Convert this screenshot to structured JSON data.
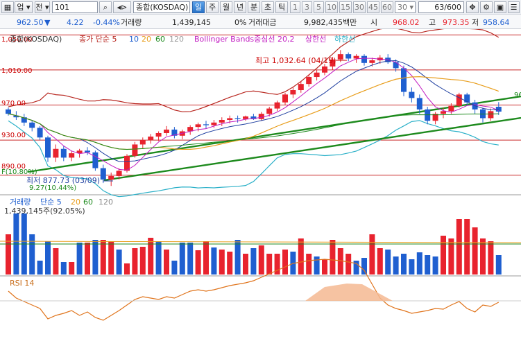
{
  "toolbar": {
    "item1": "업",
    "item2": "전",
    "code": "101",
    "market_name": "종합(KOSDAQ)",
    "periods": [
      "일",
      "주",
      "월",
      "년",
      "분",
      "초",
      "틱"
    ],
    "selected_period": "일",
    "numbers": [
      "1",
      "3",
      "5",
      "10",
      "15",
      "30",
      "45",
      "60"
    ],
    "num_select": "30",
    "count": "63",
    "total": "/600"
  },
  "info": {
    "price": "962.50",
    "change_icon": "down-triangle-icon",
    "change": "4.22",
    "change_pct": "-0.44%",
    "volume_label": "거래량",
    "volume": "1,439,145",
    "volume_ratio": "0%",
    "amount_label": "거래대금",
    "amount": "9,982,435백만",
    "open_label": "시",
    "open": "968.02",
    "high_label": "고",
    "high": "973.35",
    "low_label": "저",
    "low": "958.64"
  },
  "colors": {
    "up": "#e8232e",
    "down": "#1f5fd0",
    "ma": "#b8261f",
    "bb_center": "#c21cc2"
  },
  "price_panel": {
    "ytick_labels": [
      "1,050.00",
      "1,010.00",
      "970.00",
      "930.00",
      "890.00"
    ],
    "legend_title": "종합(KOSDAQ)",
    "legend_ma": "종가 단순 5",
    "legend_ma10": "10",
    "legend_ma20": "20",
    "legend_ma60": "60",
    "legend_ma120": "120",
    "legend_bb": "Bollinger Bands중심선 20,2",
    "legend_upper": "상한선",
    "legend_lower": "하한선",
    "high_annotation": "최고 1,032.64 (04/19)",
    "low_annotation": "최저 877.73 (03/09)",
    "left_marker_1": "F(10.80%)",
    "left_marker_2": "9.27(10.44%)",
    "right_edge_label": "96"
  },
  "volume_panel": {
    "legend_title": "거래량",
    "legend_ma": "단순 5",
    "legend_ma20": "20",
    "legend_ma60": "60",
    "legend_ma120": "120",
    "max_label": "1,439,145주(92.05%)"
  },
  "rsi_panel": {
    "legend": "RSI 14"
  },
  "chart_data": {
    "type": "candlestick",
    "ylim": [
      870,
      1055
    ],
    "candles": [
      [
        965,
        967,
        958,
        960
      ],
      [
        958,
        963,
        953,
        956
      ],
      [
        956,
        960,
        946,
        950
      ],
      [
        950,
        952,
        940,
        944
      ],
      [
        944,
        946,
        930,
        933
      ],
      [
        933,
        935,
        905,
        910
      ],
      [
        910,
        925,
        905,
        920
      ],
      [
        920,
        923,
        906,
        910
      ],
      [
        910,
        918,
        906,
        915
      ],
      [
        915,
        920,
        910,
        918
      ],
      [
        918,
        922,
        913,
        916
      ],
      [
        916,
        918,
        895,
        898
      ],
      [
        898,
        902,
        881,
        885
      ],
      [
        885,
        893,
        877.73,
        889
      ],
      [
        889,
        898,
        885,
        895
      ],
      [
        895,
        914,
        893,
        912
      ],
      [
        912,
        928,
        910,
        925
      ],
      [
        925,
        933,
        920,
        930
      ],
      [
        930,
        937,
        926,
        934
      ],
      [
        934,
        940,
        929,
        938
      ],
      [
        938,
        946,
        935,
        942
      ],
      [
        942,
        945,
        932,
        935
      ],
      [
        935,
        942,
        931,
        940
      ],
      [
        940,
        947,
        936,
        945
      ],
      [
        945,
        950,
        940,
        948
      ],
      [
        948,
        952,
        943,
        947
      ],
      [
        947,
        953,
        944,
        950
      ],
      [
        950,
        956,
        946,
        953
      ],
      [
        953,
        958,
        949,
        955
      ],
      [
        955,
        958,
        950,
        954
      ],
      [
        954,
        958,
        952,
        957
      ],
      [
        957,
        960,
        953,
        954
      ],
      [
        954,
        962,
        952,
        960
      ],
      [
        960,
        968,
        957,
        966
      ],
      [
        966,
        975,
        963,
        973
      ],
      [
        973,
        984,
        970,
        982
      ],
      [
        982,
        990,
        978,
        987
      ],
      [
        987,
        997,
        984,
        994
      ],
      [
        994,
        1005,
        991,
        1002
      ],
      [
        1002,
        1010,
        998,
        1007
      ],
      [
        1007,
        1017,
        1004,
        1014
      ],
      [
        1014,
        1025,
        1010,
        1022
      ],
      [
        1022,
        1032.64,
        1019,
        1028
      ],
      [
        1028,
        1030,
        1020,
        1023
      ],
      [
        1023,
        1028,
        1018,
        1026
      ],
      [
        1026,
        1028,
        1015,
        1018
      ],
      [
        1018,
        1024,
        1014,
        1021
      ],
      [
        1021,
        1027,
        1017,
        1024
      ],
      [
        1024,
        1028,
        1017,
        1019
      ],
      [
        1019,
        1022,
        1008,
        1012
      ],
      [
        1012,
        1015,
        980,
        985
      ],
      [
        985,
        990,
        973,
        978
      ],
      [
        978,
        982,
        960,
        965
      ],
      [
        965,
        968,
        948,
        952
      ],
      [
        952,
        962,
        948,
        960
      ],
      [
        960,
        967,
        955,
        963
      ],
      [
        963,
        972,
        960,
        969
      ],
      [
        969,
        984,
        967,
        982
      ],
      [
        982,
        984,
        970,
        973
      ],
      [
        973,
        976,
        960,
        965
      ],
      [
        965,
        967,
        950,
        955
      ],
      [
        955,
        966,
        952,
        963
      ],
      [
        968.02,
        973.35,
        958.64,
        962.5
      ]
    ],
    "volume": [
      "u",
      "d",
      "d",
      "d",
      "d",
      "d",
      "u",
      "d",
      "u",
      "d",
      "u",
      "d",
      "u",
      "u",
      "d",
      "u",
      "u",
      "u",
      "u",
      "d",
      "u",
      "d",
      "d",
      "d",
      "u",
      "u",
      "d",
      "u",
      "u",
      "d",
      "u",
      "d",
      "u",
      "u",
      "u",
      "u",
      "d",
      "u",
      "u",
      "d",
      "u",
      "u",
      "u",
      "u",
      "d",
      "d",
      "u",
      "u",
      "d",
      "d",
      "d",
      "d",
      "d",
      "d",
      "d",
      "u",
      "u",
      "u",
      "u",
      "u",
      "u",
      "u",
      "d"
    ]
  }
}
